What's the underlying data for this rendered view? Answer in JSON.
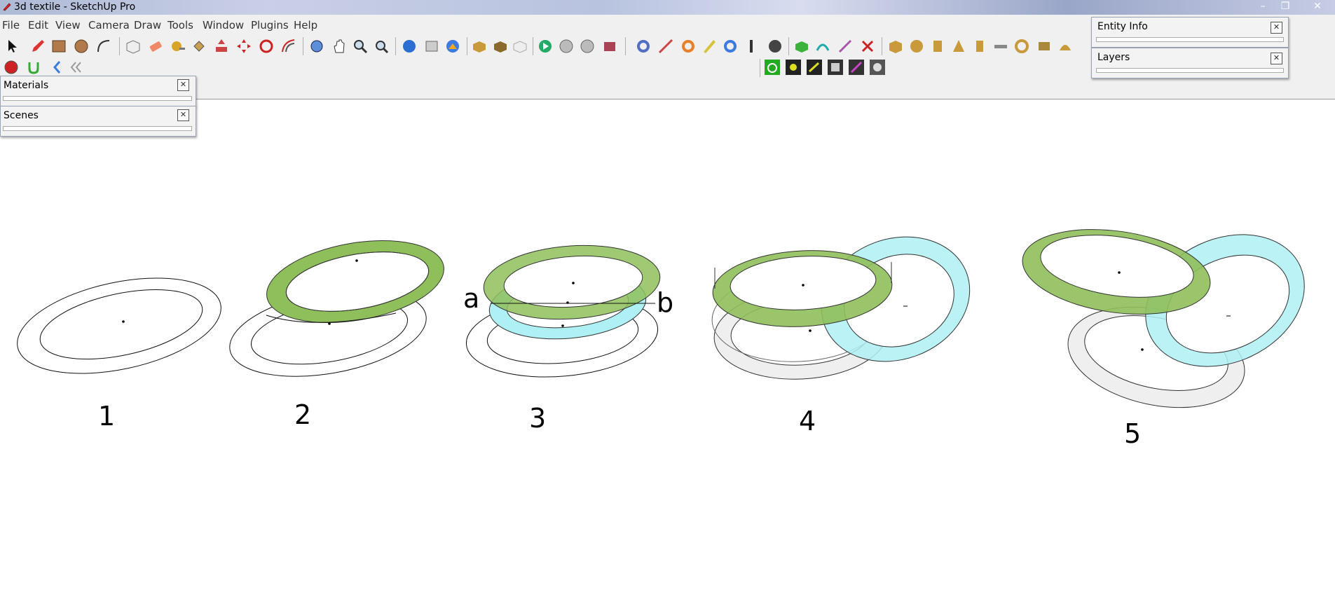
{
  "window": {
    "title": "3d textile - SketchUp Pro",
    "minimize": "–",
    "maximize": "❐",
    "close": "✕"
  },
  "menu": [
    "File",
    "Edit",
    "View",
    "Camera",
    "Draw",
    "Tools",
    "Window",
    "Plugins",
    "Help"
  ],
  "panels": {
    "materials": {
      "title": "Materials"
    },
    "scenes": {
      "title": "Scenes"
    },
    "entity_info": {
      "title": "Entity Info"
    },
    "layers": {
      "title": "Layers"
    }
  },
  "figure": {
    "labels": [
      "1",
      "2",
      "3",
      "4",
      "5"
    ],
    "point_a": "a",
    "point_b": "b",
    "colors": {
      "green": "#8fbf5a",
      "cyan": "#aef0f4",
      "gray": "#e4e4e4"
    }
  },
  "icons": [
    "select-icon",
    "pencil-icon",
    "rectangle-icon",
    "circle-icon",
    "arc-icon",
    "erase-icon",
    "paint-icon",
    "push-pull-icon",
    "move-icon",
    "rotate-icon",
    "offset-icon",
    "orbit-icon",
    "pan-icon",
    "zoom-icon",
    "zoom-extents-icon"
  ]
}
